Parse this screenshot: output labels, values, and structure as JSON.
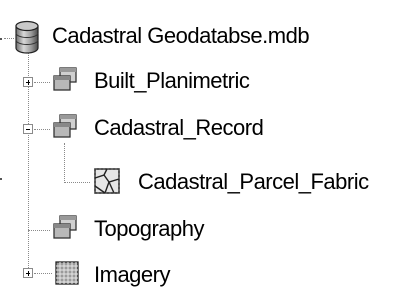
{
  "tree": {
    "root": {
      "label": "Cadastral Geodatabse.mdb",
      "icon": "database-icon"
    },
    "items": [
      {
        "label": "Built_Planimetric",
        "icon": "feature-dataset-icon",
        "toggle": "plus"
      },
      {
        "label": "Cadastral_Record",
        "icon": "feature-dataset-icon",
        "toggle": "minus"
      },
      {
        "label": "Cadastral_Parcel_Fabric",
        "icon": "parcel-fabric-icon",
        "toggle": "none"
      },
      {
        "label": "Topography",
        "icon": "feature-dataset-icon",
        "toggle": "none"
      },
      {
        "label": "Imagery",
        "icon": "raster-catalog-icon",
        "toggle": "plus"
      }
    ]
  }
}
